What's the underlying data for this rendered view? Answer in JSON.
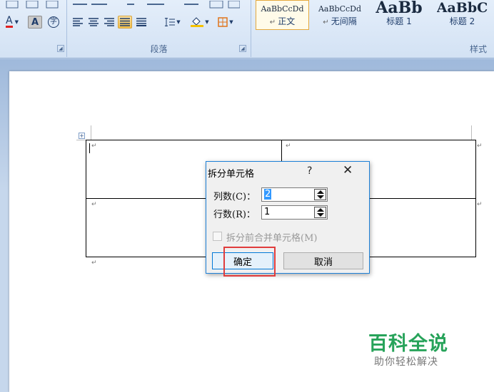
{
  "ribbon": {
    "font_color_label": "A",
    "char_shade_label": "A",
    "enclose_char_label": "字",
    "paragraph_group_label": "段落",
    "styles_group_label": "样式",
    "styles": [
      {
        "sample": "AaBbCcDd",
        "name": "正文",
        "mark": "↵",
        "active": true
      },
      {
        "sample": "AaBbCcDd",
        "name": "无间隔",
        "mark": "↵",
        "active": false
      },
      {
        "sample": "AaBb",
        "name": "标题 1",
        "mark": "",
        "active": false
      },
      {
        "sample": "AaBbC",
        "name": "标题 2",
        "mark": "",
        "active": false
      }
    ]
  },
  "document": {
    "paragraph_mark": "↵"
  },
  "dialog": {
    "title": "拆分单元格",
    "help": "?",
    "close": "✕",
    "columns_label": "列数(C)：",
    "columns_value": "2",
    "rows_label": "行数(R)：",
    "rows_value": "1",
    "merge_label": "拆分前合并单元格(M)",
    "ok_label": "确定",
    "cancel_label": "取消"
  },
  "watermark": {
    "title": "百科全说",
    "subtitle": "助你轻松解决"
  },
  "colors": {
    "ribbon_bg": "#dbe7f6",
    "dialog_border": "#1e81d8",
    "highlight_box": "#e03c3c",
    "watermark_green": "#27a35a"
  }
}
